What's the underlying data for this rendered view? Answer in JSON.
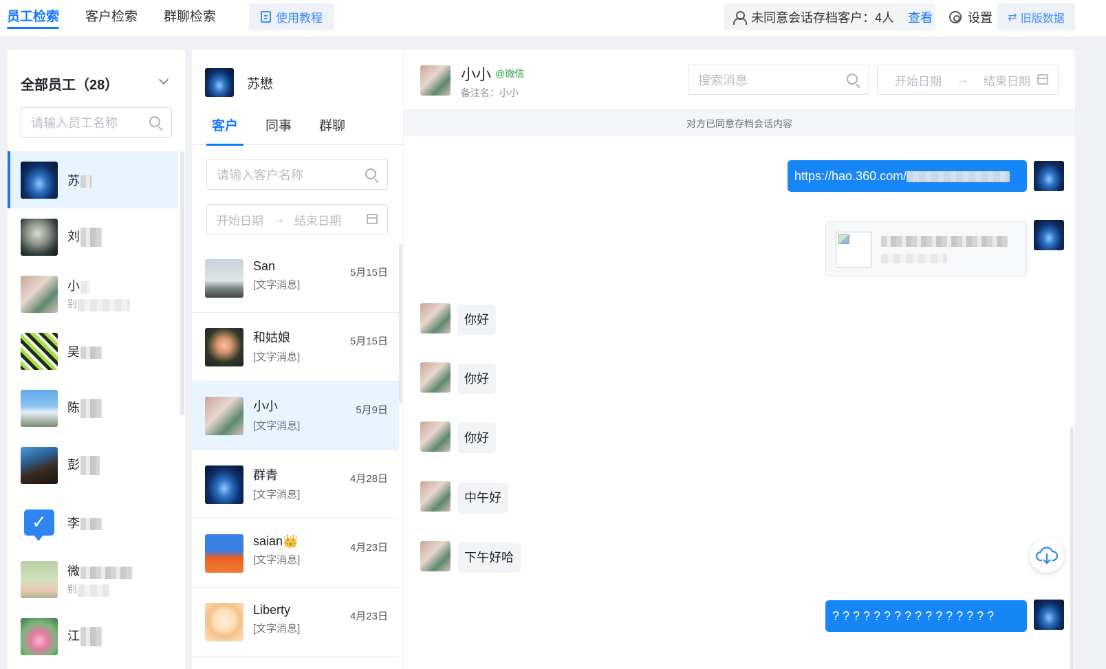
{
  "topnav": {
    "tabs": [
      {
        "label": "员工检索",
        "active": true
      },
      {
        "label": "客户检索",
        "active": false
      },
      {
        "label": "群聊检索",
        "active": false
      }
    ],
    "tutorial_label": "使用教程",
    "consent_text": "未同意会话存档客户：4人",
    "view_link": "查看",
    "settings_label": "设置",
    "old_data_label": "旧版数据"
  },
  "employees": {
    "header": "全部员工（28）",
    "search_placeholder": "请输入员工名称",
    "items": [
      {
        "name": "苏",
        "avatar": "av-night",
        "active": true
      },
      {
        "name": "刘",
        "avatar": "av-moon",
        "active": false
      },
      {
        "name": "小",
        "sub": "别",
        "avatar": "av-cat",
        "active": false
      },
      {
        "name": "吴",
        "avatar": "av-anime",
        "active": false
      },
      {
        "name": "陈",
        "avatar": "av-sky",
        "active": false
      },
      {
        "name": "彭",
        "avatar": "av-rock",
        "active": false
      },
      {
        "name": "李",
        "avatar": "av-check",
        "active": false
      },
      {
        "name": "微",
        "sub": "别",
        "avatar": "av-green",
        "active": false
      },
      {
        "name": "江",
        "avatar": "av-lotus",
        "active": false
      }
    ]
  },
  "customers": {
    "employee_name": "苏懋",
    "tabs": [
      {
        "label": "客户",
        "active": true
      },
      {
        "label": "同事",
        "active": false
      },
      {
        "label": "群聊",
        "active": false
      }
    ],
    "search_placeholder": "请输入客户名称",
    "date_start": "开始日期",
    "date_end": "结束日期",
    "items": [
      {
        "name": "San",
        "message": "[文字消息]",
        "date": "5月15日",
        "avatar": "av-sea",
        "active": false
      },
      {
        "name": "和姑娘",
        "message": "[文字消息]",
        "date": "5月15日",
        "avatar": "av-flower",
        "active": false
      },
      {
        "name": "小小",
        "message": "[文字消息]",
        "date": "5月9日",
        "avatar": "av-cat",
        "active": true
      },
      {
        "name": "群青",
        "message": "[文字消息]",
        "date": "4月28日",
        "avatar": "av-night",
        "active": false
      },
      {
        "name": "saian👑",
        "message": "[文字消息]",
        "date": "4月23日",
        "avatar": "av-wizard",
        "active": false
      },
      {
        "name": "Liberty",
        "message": "[文字消息]",
        "date": "4月23日",
        "avatar": "av-girl",
        "active": false
      }
    ]
  },
  "chat": {
    "contact_name": "小小",
    "platform_tag": "@微信",
    "remark": "备注名：小小",
    "search_placeholder": "搜索消息",
    "date_start": "开始日期",
    "date_end": "结束日期",
    "consent_banner": "对方已同意存档会话内容",
    "messages": [
      {
        "dir": "out",
        "type": "text",
        "text": "https://hao.360.com/"
      },
      {
        "dir": "out",
        "type": "card"
      },
      {
        "dir": "in",
        "type": "text",
        "text": "你好"
      },
      {
        "dir": "in",
        "type": "text",
        "text": "你好"
      },
      {
        "dir": "in",
        "type": "text",
        "text": "你好"
      },
      {
        "dir": "in",
        "type": "text",
        "text": "中午好"
      },
      {
        "dir": "in",
        "type": "text",
        "text": "下午好哈"
      },
      {
        "dir": "out",
        "type": "text",
        "text": "? ? ? ? ? ? ? ? ? ? ? ? ? ? ? ?"
      }
    ]
  },
  "icons": {
    "tutorial": "book-icon",
    "consent": "user-lock-icon",
    "settings": "gear-icon",
    "old_data": "swap-icon",
    "search": "search-icon",
    "calendar": "calendar-icon",
    "download": "cloud-download-icon"
  },
  "colors": {
    "accent": "#1677ff",
    "bubble_out": "#1685f6",
    "bubble_in": "#f2f3f5",
    "wechat_green": "#2ba245",
    "active_row": "#e8f4ff"
  }
}
